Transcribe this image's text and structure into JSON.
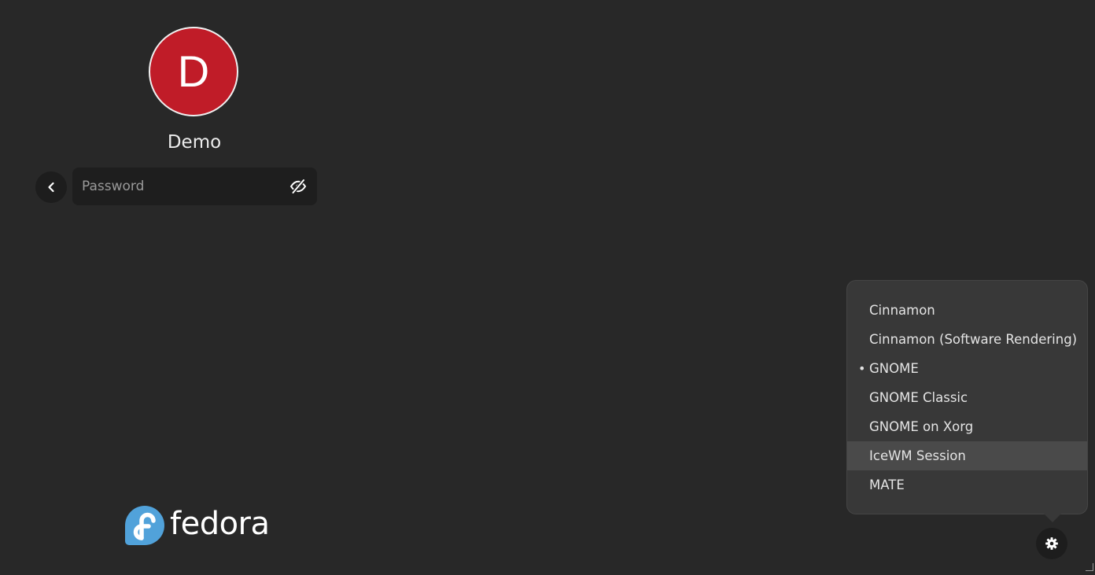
{
  "user": {
    "avatar_initial": "D",
    "avatar_color": "#c01c28",
    "name": "Demo"
  },
  "login": {
    "back_icon": "chevron-left-icon",
    "password_placeholder": "Password",
    "password_value": "",
    "reveal_icon": "eye-slash-icon"
  },
  "branding": {
    "logo_text": "fedora",
    "logo_color": "#51a2da"
  },
  "session_menu": {
    "selected": "GNOME",
    "hovered": "IceWM Session",
    "items": [
      {
        "label": "Cinnamon",
        "selected": false
      },
      {
        "label": "Cinnamon (Software Rendering)",
        "selected": false
      },
      {
        "label": "GNOME",
        "selected": true
      },
      {
        "label": "GNOME Classic",
        "selected": false
      },
      {
        "label": "GNOME on Xorg",
        "selected": false
      },
      {
        "label": "IceWM Session",
        "selected": false
      },
      {
        "label": "MATE",
        "selected": false
      }
    ],
    "selected_marker": "•"
  },
  "settings_button": {
    "icon": "gear-icon"
  },
  "colors": {
    "background": "#282828",
    "menu_background": "#383838",
    "menu_hover": "#4a4a4a",
    "button_background": "#1d1d1d"
  }
}
